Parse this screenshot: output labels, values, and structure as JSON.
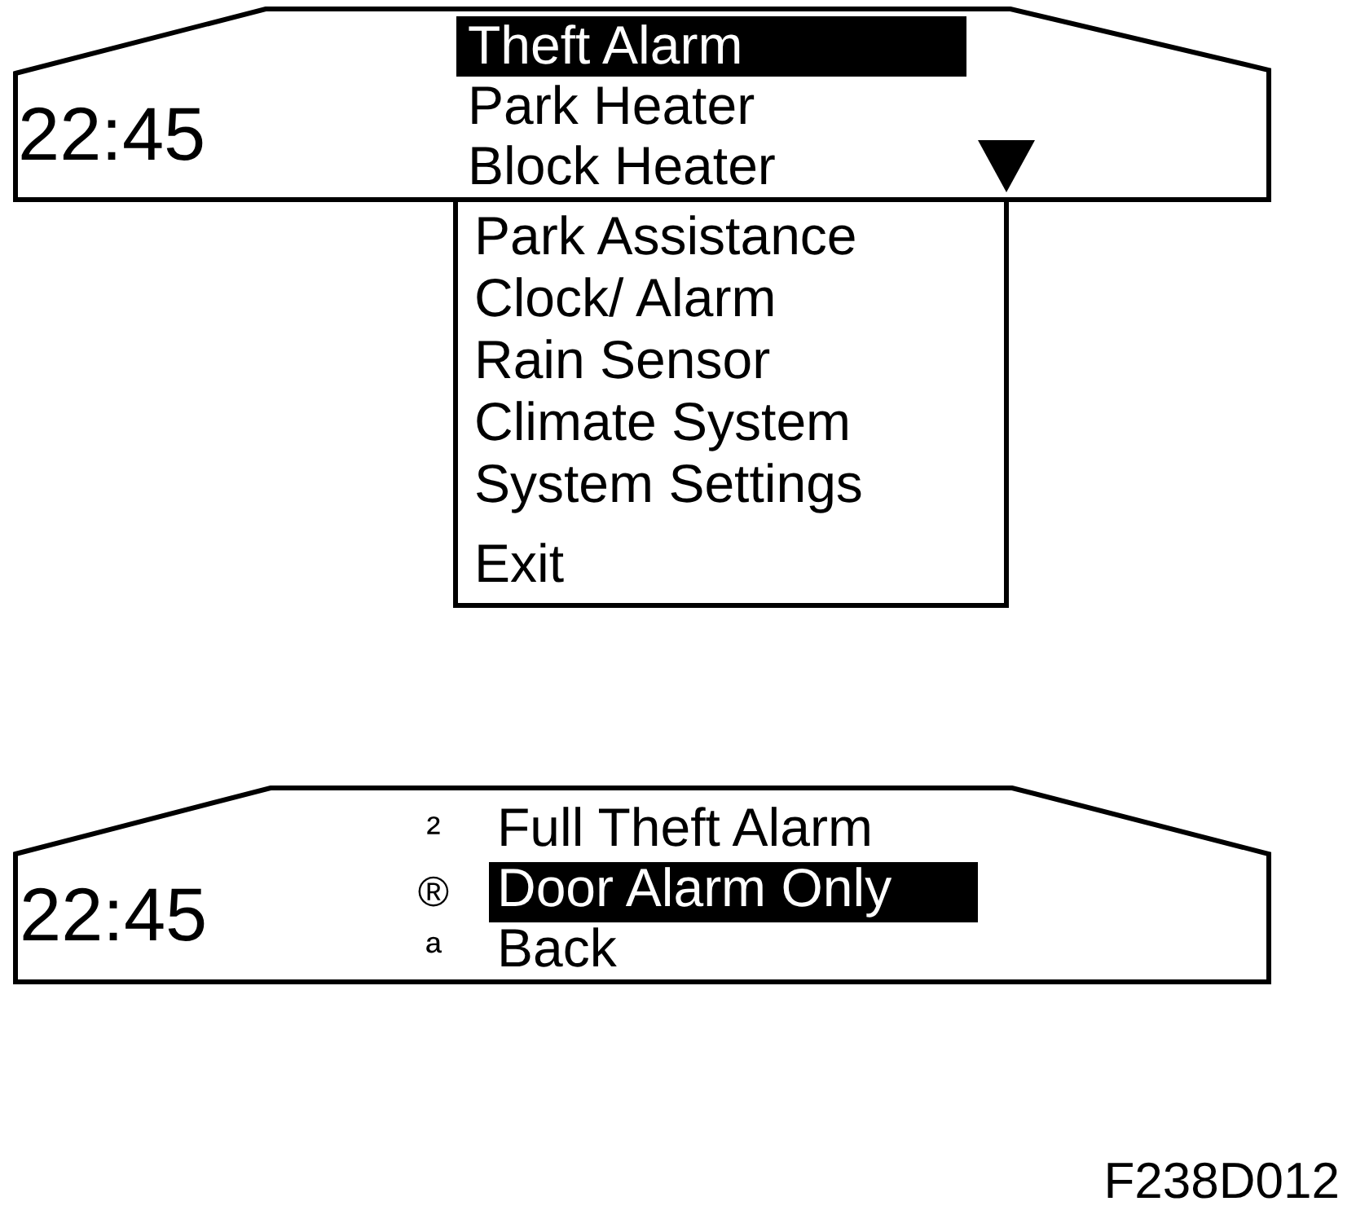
{
  "top_display": {
    "time": "22:45",
    "menu_items": [
      {
        "label": "Theft Alarm",
        "selected": true
      },
      {
        "label": "Park Heater",
        "selected": false
      },
      {
        "label": "Block Heater",
        "selected": false
      }
    ]
  },
  "dropdown_list": {
    "items": [
      {
        "label": "Park Assistance",
        "selected": false
      },
      {
        "label": "Clock/ Alarm",
        "selected": false
      },
      {
        "label": "Rain Sensor",
        "selected": false
      },
      {
        "label": "Climate System",
        "selected": false
      },
      {
        "label": "System Settings",
        "selected": false
      },
      {
        "label": "Exit",
        "selected": false
      }
    ]
  },
  "bottom_display": {
    "time": "22:45",
    "options": [
      {
        "marker": "²",
        "label": "Full Theft Alarm",
        "selected": false
      },
      {
        "marker": "®",
        "label": "Door Alarm Only",
        "selected": true
      },
      {
        "marker": "ª",
        "label": "Back",
        "selected": false
      }
    ]
  },
  "figure_code": "F238D012"
}
